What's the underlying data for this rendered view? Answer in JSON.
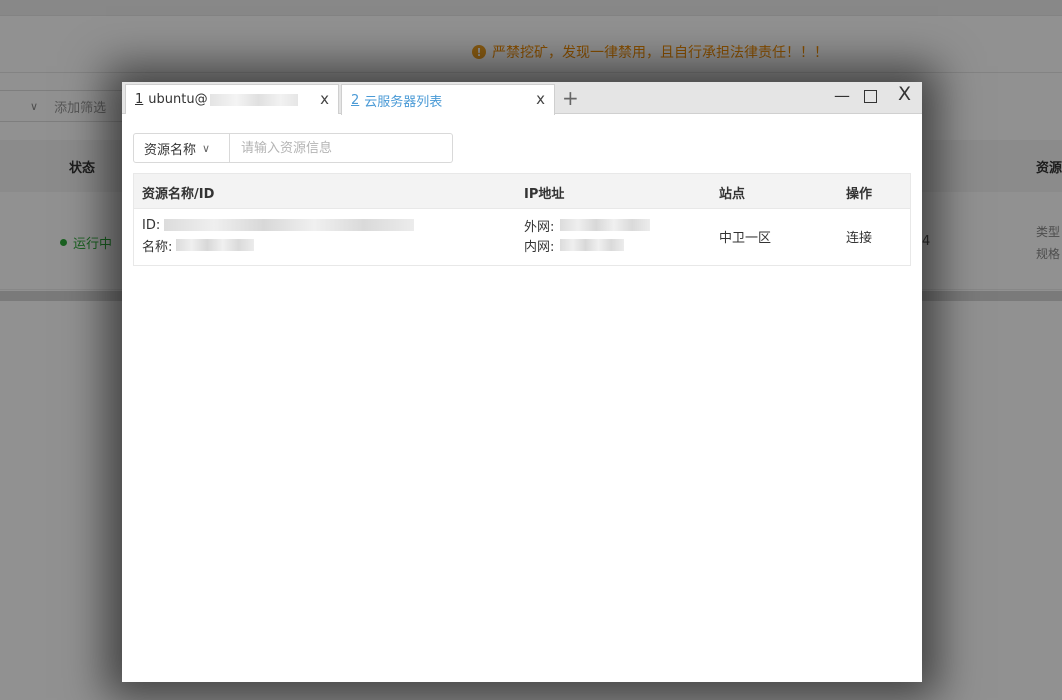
{
  "background": {
    "warning": "严禁挖矿，发现一律禁用，且自行承担法律责任！！！",
    "filter_placeholder": "添加筛选",
    "columns": {
      "status": "状态",
      "resource": "资源"
    },
    "row": {
      "status": "运行中",
      "num_tail": "4",
      "type_label": "类型",
      "spec_label": "规格"
    }
  },
  "dialog": {
    "tabs": [
      {
        "index": "1",
        "title": "ubuntu@",
        "active": false
      },
      {
        "index": "2",
        "title": "云服务器列表",
        "active": true
      }
    ],
    "add_tab_label": "+",
    "tab_close_label": "x",
    "window": {
      "minimize": "—",
      "close": "X"
    },
    "search": {
      "select_value": "资源名称",
      "placeholder": "请输入资源信息"
    },
    "table": {
      "headers": [
        "资源名称/ID",
        "IP地址",
        "站点",
        "操作"
      ],
      "rows": [
        {
          "id_label": "ID:",
          "name_label": "名称:",
          "public_ip_label": "外网:",
          "private_ip_label": "内网:",
          "site": "中卫一区",
          "action": "连接"
        }
      ]
    }
  }
}
